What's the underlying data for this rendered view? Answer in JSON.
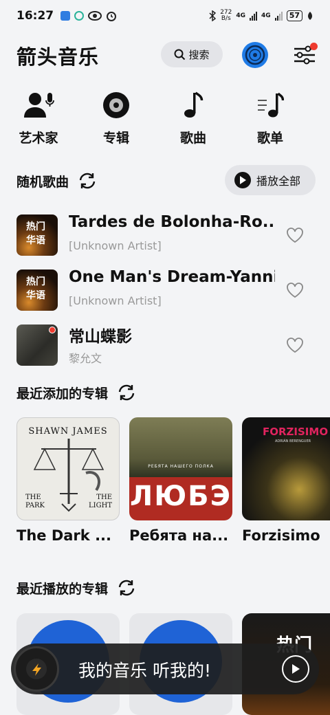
{
  "status_bar": {
    "time": "16:27",
    "net_speed_value": "272",
    "net_speed_unit": "B/s",
    "net1": "4G",
    "net2": "4G",
    "battery": "57"
  },
  "header": {
    "title": "箭头音乐",
    "search_label": "搜索"
  },
  "categories": [
    {
      "label": "艺术家",
      "icon": "artist-icon"
    },
    {
      "label": "专辑",
      "icon": "album-disc-icon"
    },
    {
      "label": "歌曲",
      "icon": "music-note-icon"
    },
    {
      "label": "歌单",
      "icon": "playlist-icon"
    }
  ],
  "random_songs": {
    "title": "随机歌曲",
    "play_all": "播放全部",
    "items": [
      {
        "name": "Tardes de Bolonha-Ro...",
        "artist": "[Unknown Artist]",
        "thumb_text": "热门华语"
      },
      {
        "name": "One Man's Dream-Yanni",
        "artist": "[Unknown Artist]",
        "thumb_text": "热门华语"
      },
      {
        "name": "常山蝶影",
        "artist": "黎允文",
        "thumb_text": ""
      }
    ]
  },
  "recent_albums": {
    "title": "最近添加的专辑",
    "items": [
      {
        "name": "The Dark ...",
        "cover_top": "SHAWN JAMES",
        "cover_mid_left": "THE PARK",
        "cover_mid_right": "THE LIGHT"
      },
      {
        "name": "Ребята на...",
        "cover_top": "РЕБЯТА НАШЕГО ПОЛКА",
        "cover_big": "ЛЮБЭ"
      },
      {
        "name": "Forzisimo",
        "cover_top": "FORZISIMO",
        "cover_sub": "ADRIÁN BERENGUER"
      }
    ]
  },
  "recent_played": {
    "title": "最近播放的专辑",
    "third_text": "热门"
  },
  "player": {
    "text": "我的音乐 听我的!"
  },
  "colors": {
    "accent_blue": "#1f7be6",
    "badge_red": "#ee3b2f",
    "background": "#f3f4f6"
  }
}
